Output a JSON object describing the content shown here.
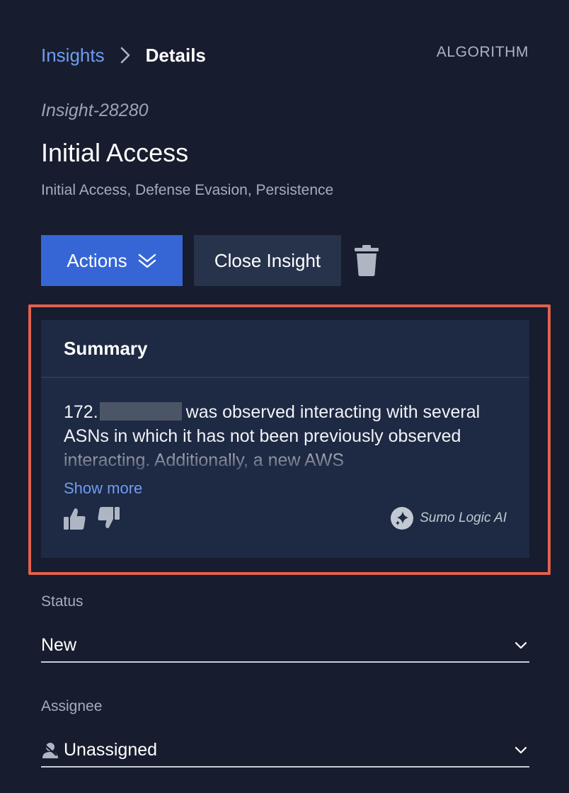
{
  "breadcrumb": {
    "parent": "Insights",
    "current": "Details"
  },
  "header": {
    "algorithm_link": "ALGORITHM"
  },
  "insight": {
    "id": "Insight-28280",
    "title": "Initial Access",
    "tactics": "Initial Access, Defense Evasion, Persistence"
  },
  "toolbar": {
    "actions_label": "Actions",
    "close_label": "Close Insight"
  },
  "summary": {
    "title": "Summary",
    "text_prefix": "172.",
    "text_rest": "was observed interacting with several ASNs in which it has not been previously observed interacting. Additionally, a new AWS",
    "show_more": "Show more",
    "ai_label": "Sumo Logic AI"
  },
  "status": {
    "label": "Status",
    "value": "New"
  },
  "assignee": {
    "label": "Assignee",
    "value": "Unassigned"
  },
  "colors": {
    "background": "#171d2e",
    "card": "#1e2943",
    "primary_button": "#3666d6",
    "secondary_button": "#27334b",
    "link": "#6f9cf0",
    "highlight_border": "#e2614e"
  },
  "icons": {
    "breadcrumb_separator": "chevron-right-icon",
    "actions_caret": "double-chevron-down-icon",
    "delete": "trash-icon",
    "feedback_positive": "thumbs-up-icon",
    "feedback_negative": "thumbs-down-icon",
    "ai": "sparkle-icon",
    "select_caret": "chevron-down-icon",
    "assignee": "user-icon"
  }
}
